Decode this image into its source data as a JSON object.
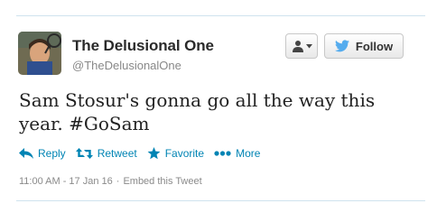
{
  "author": {
    "full_name": "The Delusional One",
    "screen_name": "@TheDelusionalOne"
  },
  "buttons": {
    "follow_label": "Follow"
  },
  "tweet": {
    "text_line1": "Sam Stosur's gonna go all the way this",
    "text_line2": "year. ",
    "hashtag": "#GoSam"
  },
  "actions": {
    "reply": "Reply",
    "retweet": "Retweet",
    "favorite": "Favorite",
    "more": "More"
  },
  "meta": {
    "timestamp": "11:00 AM - 17 Jan 16",
    "separator": "·",
    "embed": "Embed this Tweet"
  },
  "colors": {
    "link": "#0084b4",
    "twitter_blue": "#55acee"
  }
}
